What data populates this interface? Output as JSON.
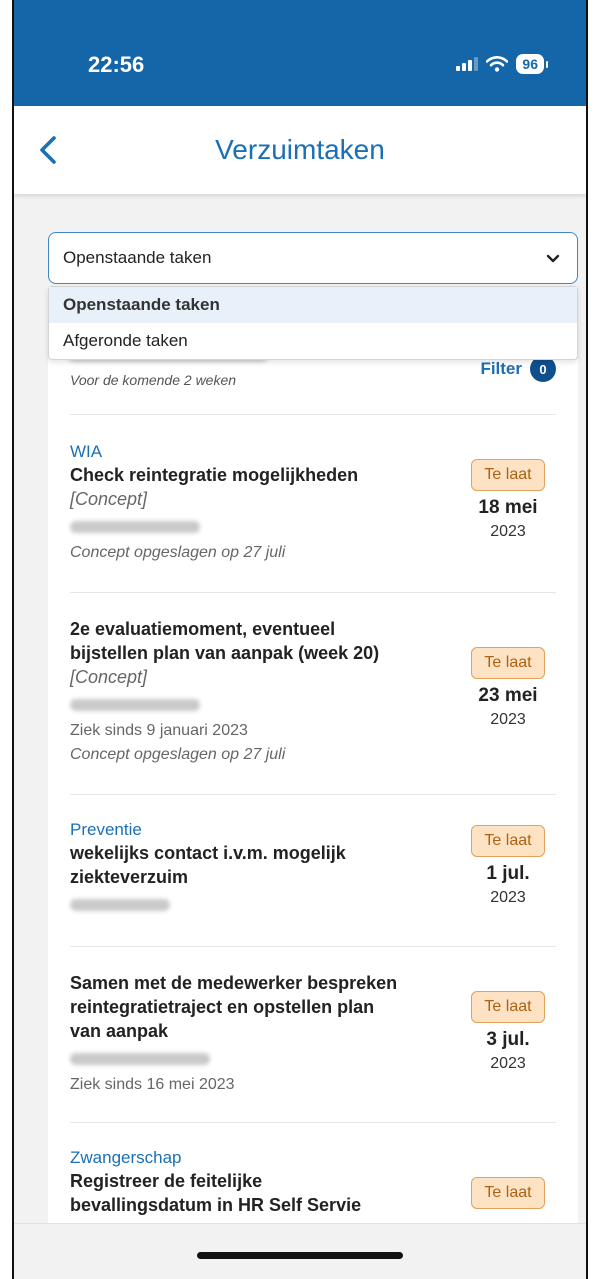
{
  "status": {
    "time": "22:56",
    "battery": "96"
  },
  "nav": {
    "title": "Verzuimtaken"
  },
  "dropdown": {
    "value": "Openstaande taken",
    "options": [
      "Openstaande taken",
      "Afgeronde taken"
    ]
  },
  "list": {
    "subtitle": "Voor de komende 2 weken",
    "filter_label": "Filter",
    "filter_count": "0"
  },
  "tasks": [
    {
      "category": "WIA",
      "title": "Check reintegratie mogelijkheden",
      "concept": "[Concept]",
      "meta": [],
      "note": "Concept opgeslagen op 27 juli",
      "badge": "Te laat",
      "day": "18 mei",
      "year": "2023"
    },
    {
      "category": "",
      "title": "2e evaluatiemoment, eventueel bijstellen plan van aanpak (week 20)",
      "concept": "[Concept]",
      "meta": [
        "Ziek sinds 9 januari 2023"
      ],
      "note": "Concept opgeslagen op 27 juli",
      "badge": "Te laat",
      "day": "23 mei",
      "year": "2023"
    },
    {
      "category": "Preventie",
      "title": "wekelijks contact i.v.m. mogelijk ziekteverzuim",
      "concept": "",
      "meta": [],
      "note": "",
      "badge": "Te laat",
      "day": "1 jul.",
      "year": "2023"
    },
    {
      "category": "",
      "title": "Samen met de medewerker bespreken reintegratietraject en opstellen plan van aanpak",
      "concept": "",
      "meta": [
        "Ziek sinds 16 mei 2023"
      ],
      "note": "",
      "badge": "Te laat",
      "day": "3 jul.",
      "year": "2023"
    },
    {
      "category": "Zwangerschap",
      "title": "Registreer de feitelijke bevallingsdatum in HR Self Servie",
      "concept": "",
      "meta": [],
      "note": "",
      "badge": "Te laat",
      "day": "",
      "year": ""
    }
  ]
}
